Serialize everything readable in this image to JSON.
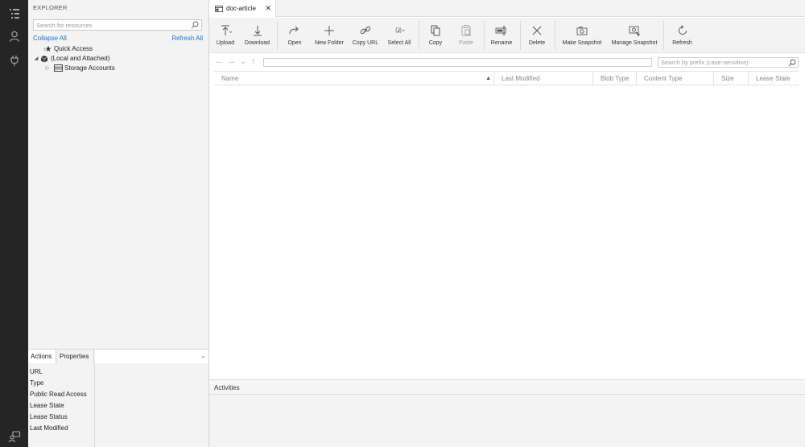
{
  "explorer": {
    "title": "EXPLORER",
    "search_placeholder": "Search for resources",
    "collapse_all": "Collapse All",
    "refresh_all": "Refresh All",
    "tree": [
      {
        "label": "Quick Access",
        "icon": "quick-access-icon",
        "expander": ""
      },
      {
        "label": "(Local and Attached)",
        "icon": "cube-icon",
        "expander": "◢"
      },
      {
        "label": "Storage Accounts",
        "icon": "storage-account-icon",
        "expander": "▷"
      }
    ]
  },
  "properties_panel": {
    "tabs": [
      "Actions",
      "Properties"
    ],
    "rows": [
      "URL",
      "Type",
      "Public Read Access",
      "Lease State",
      "Lease Status",
      "Last Modified"
    ]
  },
  "editor": {
    "tab_title": "doc-article",
    "toolbar": [
      {
        "label": "Upload",
        "icon": "upload-icon",
        "disabled": false
      },
      {
        "label": "Download",
        "icon": "download-icon",
        "disabled": false
      },
      {
        "label": "Open",
        "icon": "open-icon",
        "disabled": false
      },
      {
        "label": "New Folder",
        "icon": "plus-icon",
        "disabled": false
      },
      {
        "label": "Copy URL",
        "icon": "link-icon",
        "disabled": false
      },
      {
        "label": "Select All",
        "icon": "select-all-icon",
        "disabled": false
      },
      {
        "label": "Copy",
        "icon": "copy-icon",
        "disabled": false
      },
      {
        "label": "Paste",
        "icon": "paste-icon",
        "disabled": true
      },
      {
        "label": "Rename",
        "icon": "rename-icon",
        "disabled": false
      },
      {
        "label": "Delete",
        "icon": "delete-icon",
        "disabled": false
      },
      {
        "label": "Make Snapshot",
        "icon": "camera-icon",
        "disabled": false
      },
      {
        "label": "Manage Snapshot",
        "icon": "manage-snapshot-icon",
        "disabled": false
      },
      {
        "label": "Refresh",
        "icon": "refresh-icon",
        "disabled": false
      }
    ],
    "prefix_search_placeholder": "Search by prefix (case-sensitive)",
    "columns": [
      "Name",
      "Last Modified",
      "Blob Type",
      "Content Type",
      "Size",
      "Lease State"
    ]
  },
  "activities": {
    "title": "Activities"
  }
}
